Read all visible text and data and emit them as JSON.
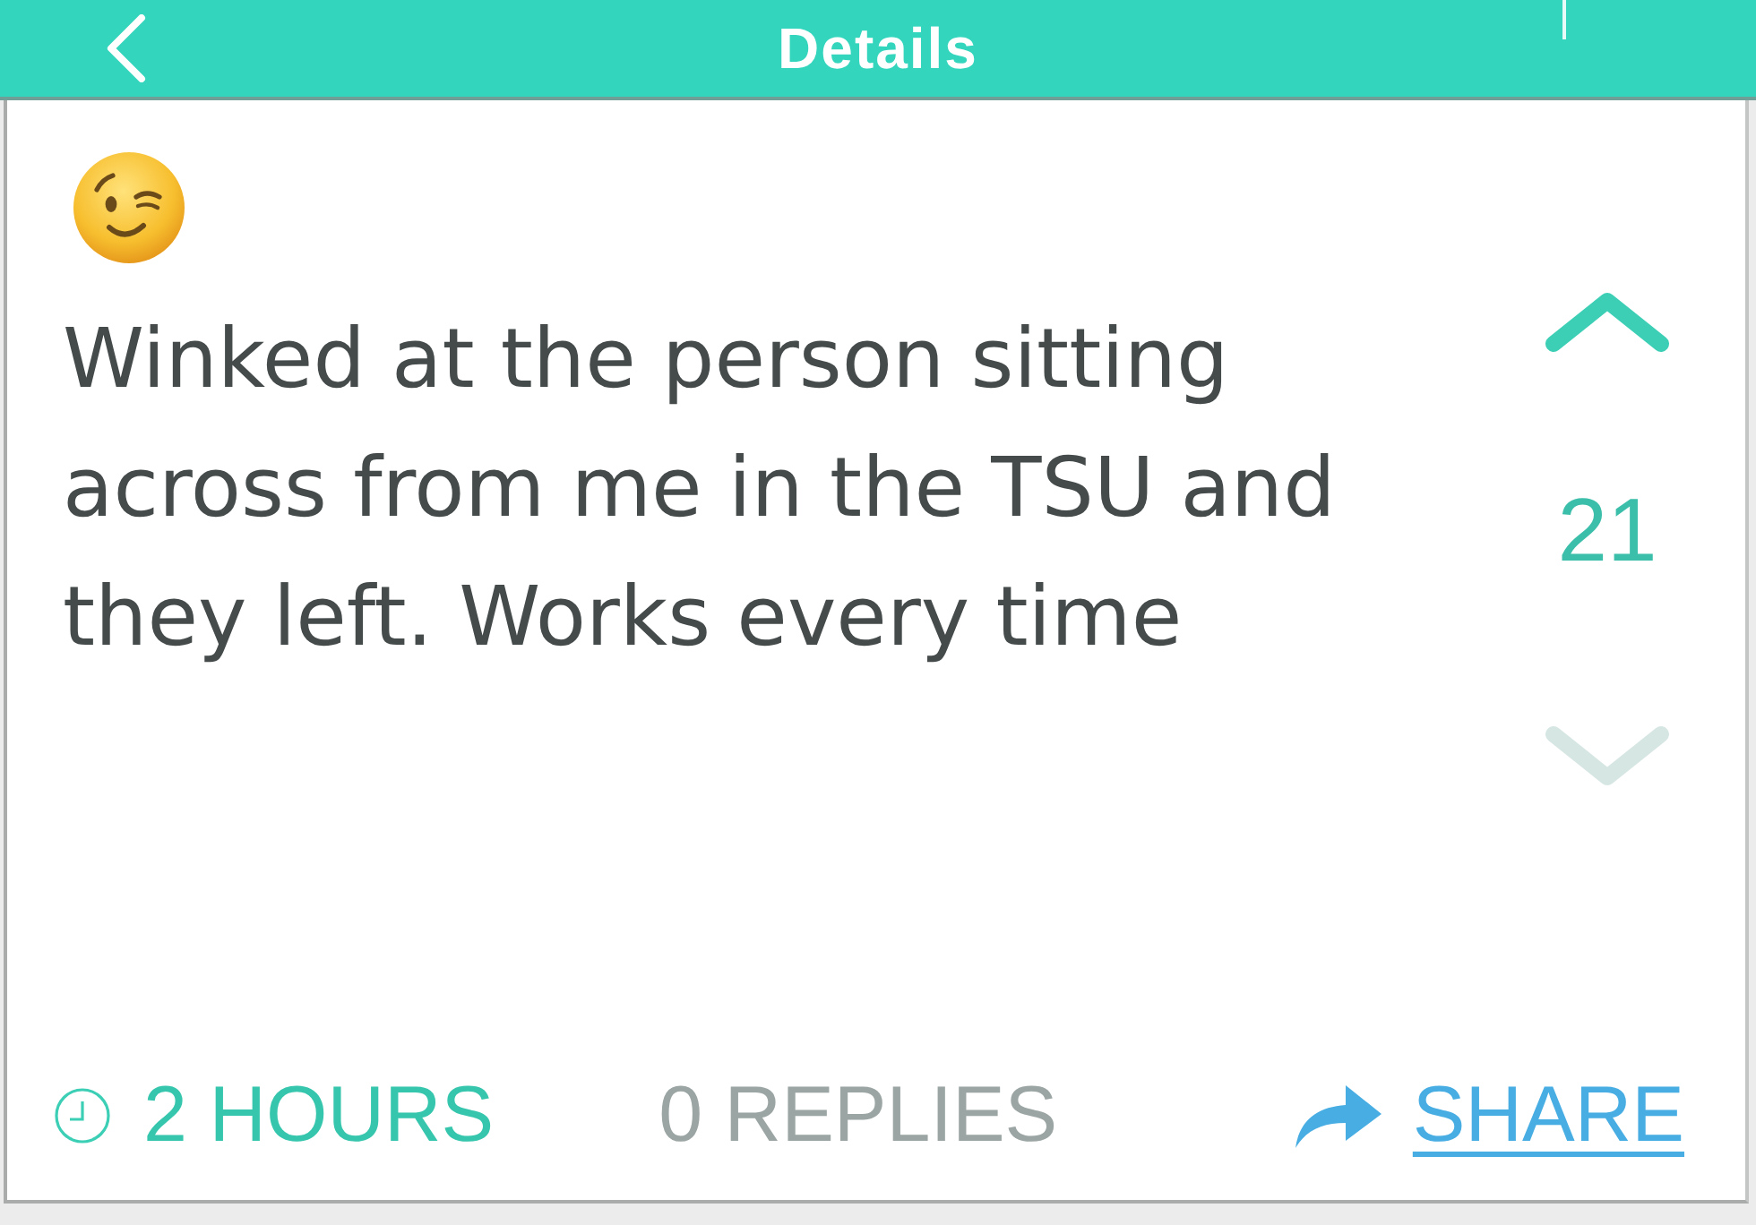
{
  "header": {
    "title": "Details"
  },
  "post": {
    "text": "Winked at the person sitting across from me in the TSU and they left. Works every time",
    "votes": {
      "count": "21",
      "up": {
        "selected": true
      },
      "down": {
        "selected": false
      }
    }
  },
  "footer": {
    "time": "2 HOURS",
    "replies": "0 REPLIES",
    "share": "SHARE"
  }
}
